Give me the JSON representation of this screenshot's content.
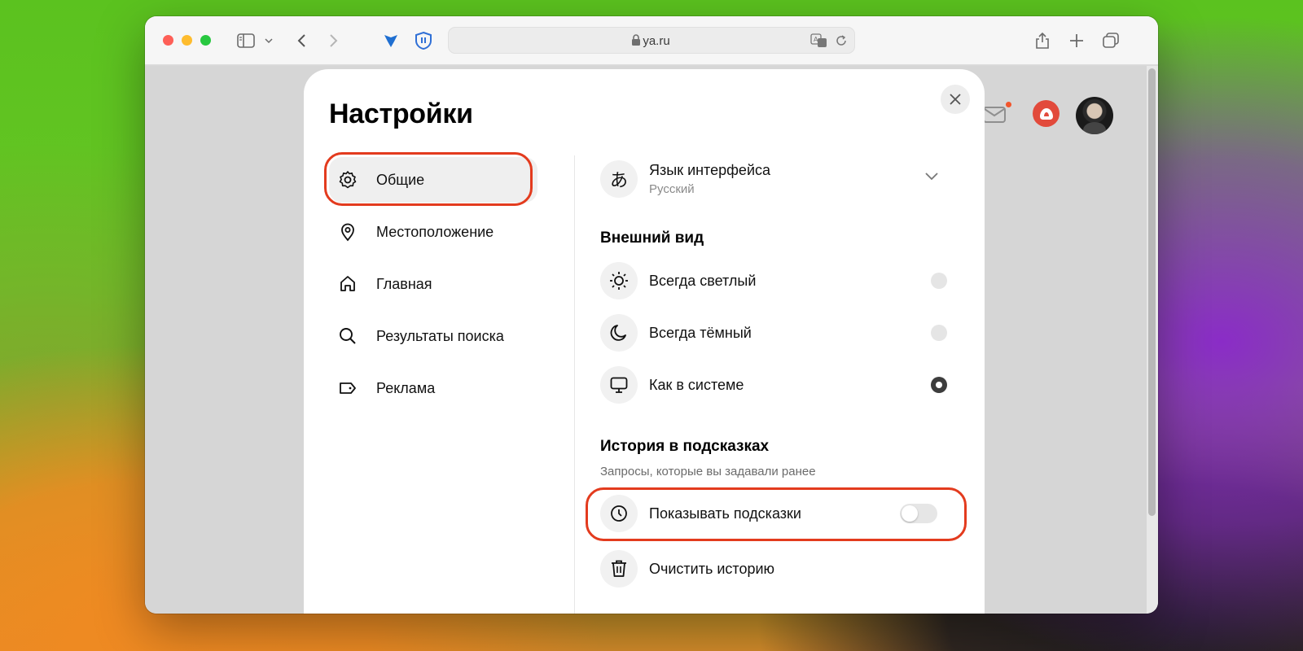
{
  "browser": {
    "url": "ya.ru",
    "icons": [
      "sidebar-icon",
      "chevron-down-icon",
      "back-icon",
      "forward-icon",
      "extension-icon",
      "shield-icon",
      "lock-icon",
      "translate-icon",
      "reload-icon",
      "share-icon",
      "plus-icon",
      "tabs-icon"
    ]
  },
  "header": {
    "icons": [
      "mail-icon",
      "alice-icon",
      "avatar"
    ]
  },
  "settings": {
    "title": "Настройки",
    "nav": [
      {
        "label": "Общие",
        "icon": "gear-icon",
        "active": true
      },
      {
        "label": "Местоположение",
        "icon": "location-pin-icon",
        "active": false
      },
      {
        "label": "Главная",
        "icon": "home-icon",
        "active": false
      },
      {
        "label": "Результаты поиска",
        "icon": "search-icon",
        "active": false
      },
      {
        "label": "Реклама",
        "icon": "ad-tag-icon",
        "active": false
      }
    ],
    "language": {
      "label": "Язык интерфейса",
      "value": "Русский",
      "icon": "language-icon",
      "glyph": "あ"
    },
    "appearance": {
      "title": "Внешний вид",
      "options": [
        {
          "label": "Всегда светлый",
          "icon": "sun-icon",
          "selected": false
        },
        {
          "label": "Всегда тёмный",
          "icon": "moon-icon",
          "selected": false
        },
        {
          "label": "Как в системе",
          "icon": "monitor-icon",
          "selected": true
        }
      ]
    },
    "history": {
      "title": "История в подсказках",
      "subtitle": "Запросы, которые вы задавали ранее",
      "show_hints": {
        "label": "Показывать подсказки",
        "icon": "clock-icon",
        "enabled": false
      },
      "clear": {
        "label": "Очистить историю",
        "icon": "trash-icon"
      }
    }
  },
  "colors": {
    "highlight": "#e33b1e",
    "alice": "#e24a3b",
    "mail_badge": "#f2552c"
  }
}
